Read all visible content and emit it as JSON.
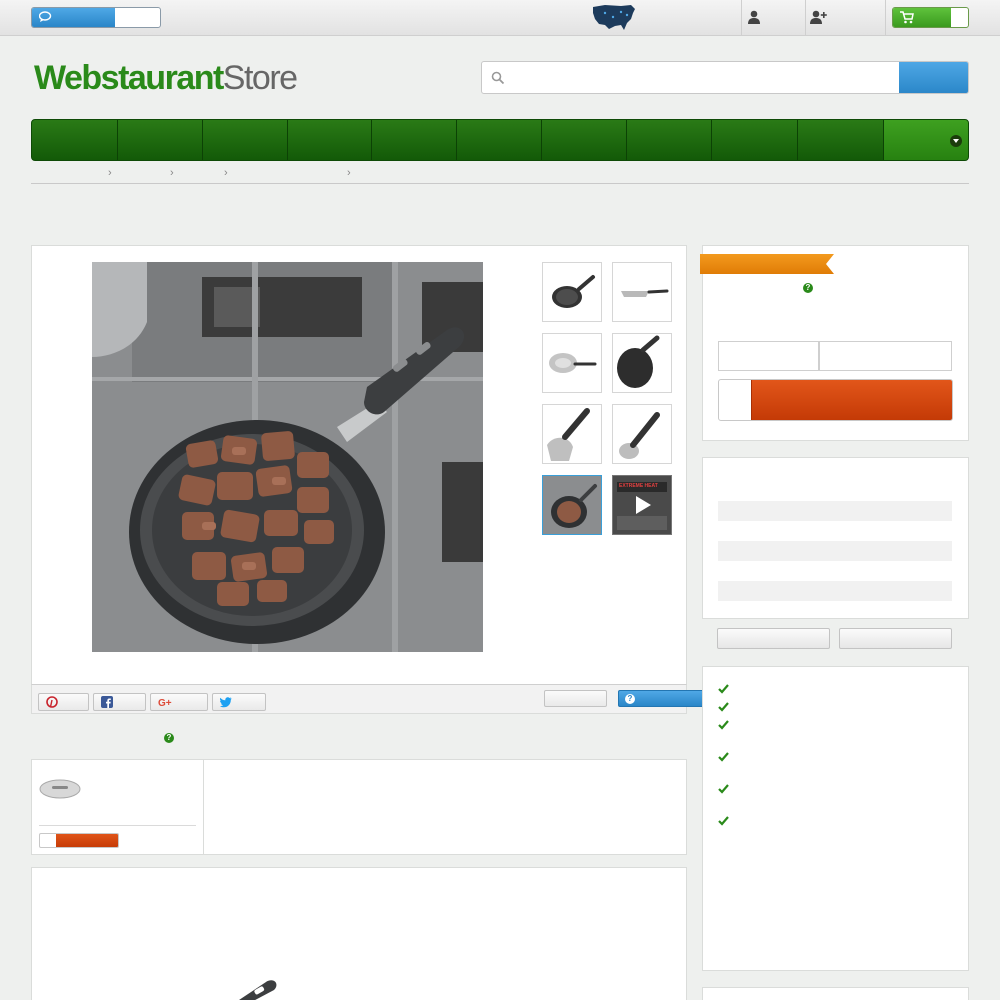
{
  "brand": {
    "logo_bold": "Webstaurant",
    "logo_light": "Store"
  },
  "topbar": {
    "icons": [
      "chat-icon",
      "us-map-icon",
      "user-icon",
      "add-user-icon",
      "cart-icon"
    ]
  },
  "search": {
    "placeholder": "",
    "value": ""
  },
  "colors": {
    "brand_green": "#2a8a1a",
    "nav_green": "#135a08",
    "accent_blue": "#2a86c8",
    "add_to_cart_red": "#c43a06",
    "ribbon_orange": "#e07c06"
  },
  "share": {
    "icons": [
      "pinterest-icon",
      "facebook-icon",
      "google-plus-icon",
      "twitter-icon"
    ]
  },
  "thumbnails": [
    "pan-top-view",
    "pan-side-view",
    "pan-bottom-view",
    "pan-angle-view",
    "pan-handle-view",
    "pan-handle-closeup",
    "pan-with-beef",
    "video-thumbnail"
  ],
  "video_thumb_text": "EXTREME HEAT"
}
